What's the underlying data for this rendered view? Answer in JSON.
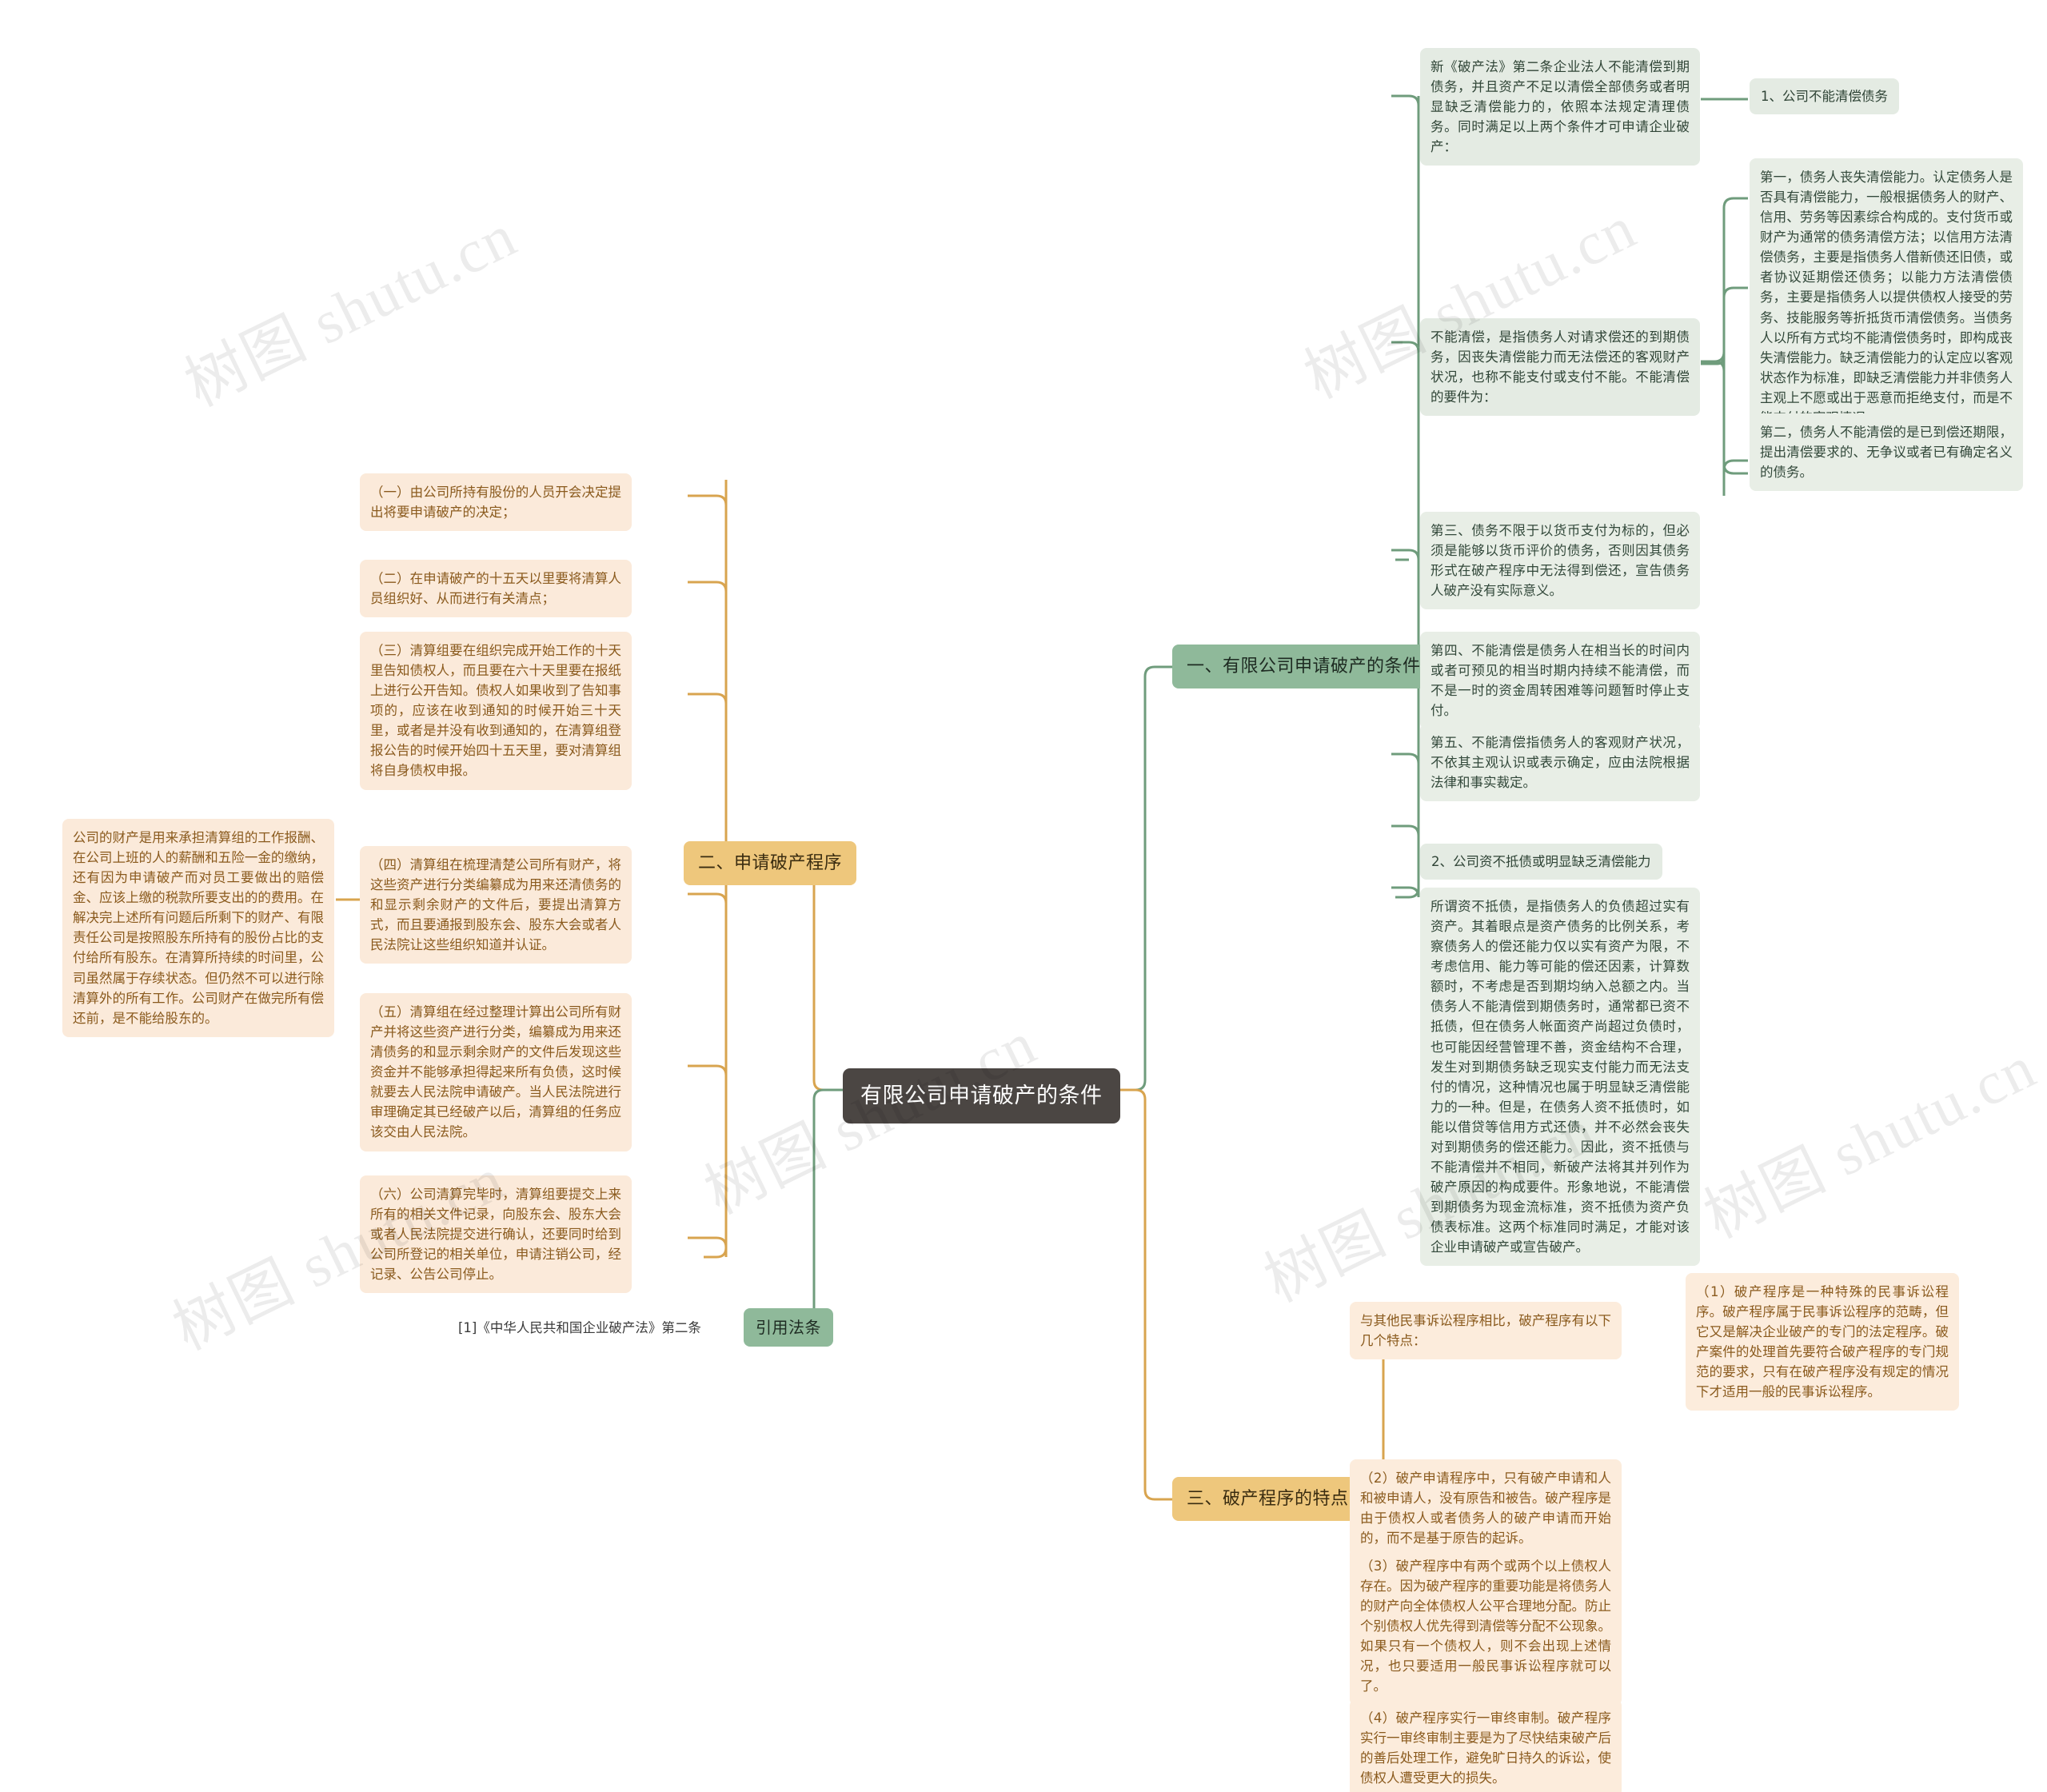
{
  "root": {
    "label": "有限公司申请破产的条件"
  },
  "watermarks": [
    "树图 shutu.cn",
    "树图 shutu.cn",
    "树图 shutu.cn",
    "树图 shutu.cn",
    "树图 shutu.cn",
    "树图 shutu.cn"
  ],
  "colors": {
    "root_bg": "#4b4643",
    "branch_green": "#8fb99a",
    "branch_gold": "#eec77c",
    "leaf_green": "#e4ebe3",
    "leaf_peach": "#fbeada",
    "wire_green": "#6f9c7c",
    "wire_gold": "#d8a44f"
  },
  "branches": {
    "b1": {
      "label": "一、有限公司申请破产的条件"
    },
    "b2": {
      "label": "二、申请破产程序"
    },
    "b3": {
      "label": "三、破产程序的特点"
    },
    "b4": {
      "label": "引用法条"
    }
  },
  "branch1": {
    "intro": "新《破产法》第二条企业法人不能清偿到期债务，并且资产不足以清偿全部债务或者明显缺乏清偿能力的，依照本法规定清理债务。同时满足以上两个条件才可申请企业破产：",
    "sub1": {
      "label": "1、公司不能清偿债务",
      "def": "不能清偿，是指债务人对请求偿还的到期债务，因丧失清偿能力而无法偿还的客观财产状况，也称不能支付或支付不能。不能清偿的要件为：",
      "points": [
        "第一，债务人丧失清偿能力。认定债务人是否具有清偿能力，一般根据债务人的财产、信用、劳务等因素综合构成的。支付货币或财产为通常的债务清偿方法；以信用方法清偿债务，主要是指债务人借新债还旧债，或者协议延期偿还债务；以能力方法清偿债务，主要是指债务人以提供债权人接受的劳务、技能服务等折抵货币清偿债务。当债务人以所有方式均不能清偿债务时，即构成丧失清偿能力。缺乏清偿能力的认定应以客观状态作为标准，即缺乏清偿能力并非债务人主观上不愿或出于恶意而拒绝支付，而是不能支付的客观情况。",
        "第二，债务人不能清偿的是已到偿还期限，提出清偿要求的、无争议或者已有确定名义的债务。",
        "第三、债务不限于以货币支付为标的，但必须是能够以货币评价的债务，否则因其债务形式在破产程序中无法得到偿还，宣告债务人破产没有实际意义。",
        "第四、不能清偿是债务人在相当长的时间内或者可预见的相当时期内持续不能清偿，而不是一时的资金周转困难等问题暂时停止支付。",
        "第五、不能清偿指债务人的客观财产状况，不依其主观认识或表示确定，应由法院根据法律和事实裁定。"
      ]
    },
    "sub2": {
      "label": "2、公司资不抵债或明显缺乏清偿能力",
      "def": "所谓资不抵债，是指债务人的负债超过实有资产。其着眼点是资产债务的比例关系，考察债务人的偿还能力仅以实有资产为限，不考虑信用、能力等可能的偿还因素，计算数额时，不考虑是否到期均纳入总额之内。当债务人不能清偿到期债务时，通常都已资不抵债，但在债务人帐面资产尚超过负债时，也可能因经营管理不善，资金结构不合理，发生对到期债务缺乏现实支付能力而无法支付的情况，这种情况也属于明显缺乏清偿能力的一种。但是，在债务人资不抵债时，如能以借贷等信用方式还债，并不必然会丧失对到期债务的偿还能力。因此，资不抵债与不能清偿并不相同，新破产法将其并列作为破产原因的构成要件。形象地说，不能清偿到期债务为现金流标准，资不抵债为资产负债表标准。这两个标准同时满足，才能对该企业申请破产或宣告破产。"
    }
  },
  "branch2": {
    "items": [
      "（一）由公司所持有股份的人员开会决定提出将要申请破产的决定；",
      "（二）在申请破产的十五天以里要将清算人员组织好、从而进行有关清点；",
      "（三）清算组要在组织完成开始工作的十天里告知债权人，而且要在六十天里要在报纸上进行公开告知。债权人如果收到了告知事项的，应该在收到通知的时候开始三十天里，或者是并没有收到通知的，在清算组登报公告的时候开始四十五天里，要对清算组将自身债权申报。",
      "（四）清算组在梳理清楚公司所有财产，将这些资产进行分类编纂成为用来还清债务的和显示剩余财产的文件后，要提出清算方式，而且要通报到股东会、股东大会或者人民法院让这些组织知道并认证。",
      "（五）清算组在经过整理计算出公司所有财产并将这些资产进行分类，编纂成为用来还清债务的和显示剩余财产的文件后发现这些资金并不能够承担得起来所有负债，这时候就要去人民法院申请破产。当人民法院进行审理确定其已经破产以后，清算组的任务应该交由人民法院。",
      "（六）公司清算完毕时，清算组要提交上来所有的相关文件记录，向股东会、股东大会或者人民法院提交进行确认，还要同时给到公司所登记的相关单位，申请注销公司，经记录、公告公司停止。"
    ],
    "note": "公司的财产是用来承担清算组的工作报酬、在公司上班的人的薪酬和五险一金的缴纳，还有因为申请破产而对员工要做出的赔偿金、应该上缴的税款所要支出的的费用。在解决完上述所有问题后所剩下的财产、有限责任公司是按照股东所持有的股份占比的支付给所有股东。在清算所持续的时间里，公司虽然属于存续状态。但仍然不可以进行除清算外的所有工作。公司财产在做完所有偿还前，是不能给股东的。"
  },
  "branch3": {
    "intro": "与其他民事诉讼程序相比，破产程序有以下几个特点：",
    "items": [
      "（1）破产程序是一种特殊的民事诉讼程序。破产程序属于民事诉讼程序的范畴，但它又是解决企业破产的专门的法定程序。破产案件的处理首先要符合破产程序的专门规范的要求，只有在破产程序没有规定的情况下才适用一般的民事诉讼程序。",
      "（2）破产申请程序中，只有破产申请和人和被申请人，没有原告和被告。破产程序是由于债权人或者债务人的破产申请而开始的，而不是基于原告的起诉。",
      "（3）破产程序中有两个或两个以上债权人存在。因为破产程序的重要功能是将债务人的财产向全体债权人公平合理地分配。防止个别债权人优先得到清偿等分配不公现象。如果只有一个债权人，则不会出现上述情况，也只要适用一般民事诉讼程序就可以了。",
      "（4）破产程序实行一审终审制。破产程序实行一审终审制主要是为了尽快结束破产后的善后处理工作，避免旷日持久的诉讼，使债权人遭受更大的损失。"
    ]
  },
  "branch4": {
    "citation": "[1]《中华人民共和国企业破产法》第二条"
  }
}
